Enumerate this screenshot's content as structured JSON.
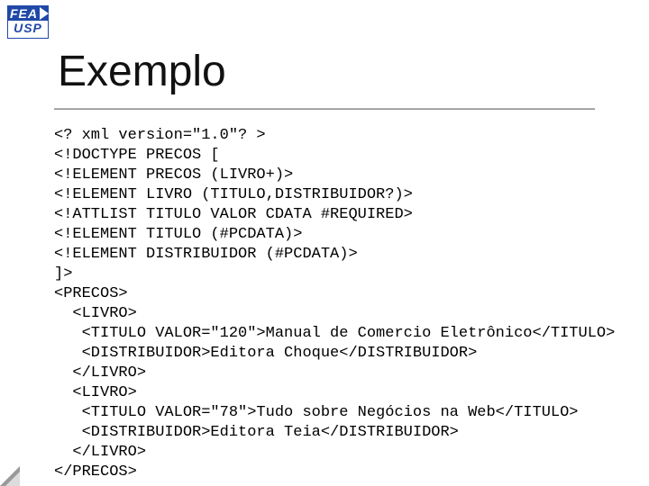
{
  "logo": {
    "top": "FEA",
    "bottom": "USP"
  },
  "title": "Exemplo",
  "code": "<? xml version=\"1.0\"? >\n<!DOCTYPE PRECOS [\n<!ELEMENT PRECOS (LIVRO+)>\n<!ELEMENT LIVRO (TITULO,DISTRIBUIDOR?)>\n<!ATTLIST TITULO VALOR CDATA #REQUIRED>\n<!ELEMENT TITULO (#PCDATA)>\n<!ELEMENT DISTRIBUIDOR (#PCDATA)>\n]>\n<PRECOS>\n  <LIVRO>\n   <TITULO VALOR=\"120\">Manual de Comercio Eletrônico</TITULO>\n   <DISTRIBUIDOR>Editora Choque</DISTRIBUIDOR>\n  </LIVRO>\n  <LIVRO>\n   <TITULO VALOR=\"78\">Tudo sobre Negócios na Web</TITULO>\n   <DISTRIBUIDOR>Editora Teia</DISTRIBUIDOR>\n  </LIVRO>\n</PRECOS>"
}
